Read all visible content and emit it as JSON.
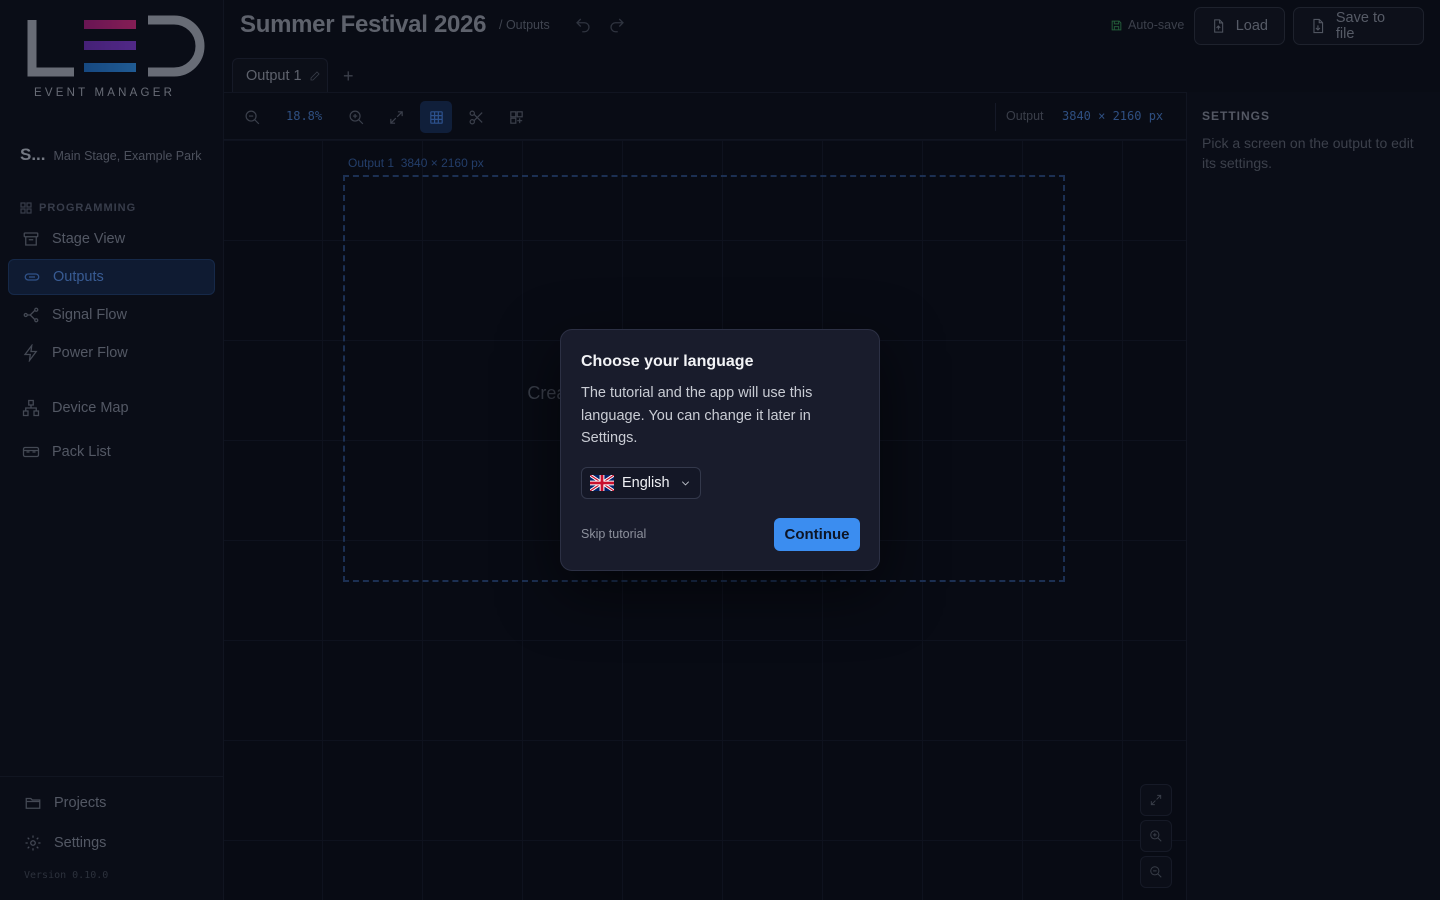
{
  "app": {
    "logo_text": "LED",
    "logo_subtitle": "EVENT MANAGER",
    "version": "Version 0.10.0"
  },
  "project": {
    "name": "S...",
    "location": "Main Stage, Example Park",
    "title": "Summer Festival 2026",
    "breadcrumb": "/ Outputs"
  },
  "sidebar": {
    "section_label": "PROGRAMMING",
    "items": [
      {
        "label": "Stage View",
        "icon": "stage-icon",
        "active": false
      },
      {
        "label": "Outputs",
        "icon": "outputs-icon",
        "active": true
      },
      {
        "label": "Signal Flow",
        "icon": "signal-flow-icon",
        "active": false
      },
      {
        "label": "Power Flow",
        "icon": "power-icon",
        "active": false
      },
      {
        "label": "Device Map",
        "icon": "device-map-icon",
        "active": false
      },
      {
        "label": "Pack List",
        "icon": "pack-list-icon",
        "active": false
      }
    ],
    "bottom": [
      {
        "label": "Projects",
        "icon": "folder-icon"
      },
      {
        "label": "Settings",
        "icon": "gear-icon"
      }
    ]
  },
  "header": {
    "autosave_label": "Auto-save",
    "load_label": "Load",
    "save_label": "Save to file"
  },
  "tabs": [
    {
      "label": "Output 1",
      "active": true
    }
  ],
  "toolbar": {
    "zoom": "18.8%",
    "output_label": "Output",
    "output_size": "3840 × 2160 px"
  },
  "canvas": {
    "output_name": "Output 1",
    "output_size": "3840 × 2160 px",
    "empty_message": "Create screens to place them on this output."
  },
  "settings_panel": {
    "title": "SETTINGS",
    "hint": "Pick a screen on the output to edit its settings."
  },
  "modal": {
    "title": "Choose your language",
    "body": "The tutorial and the app will use this language. You can change it later in Settings.",
    "language": "English",
    "skip_label": "Skip tutorial",
    "continue_label": "Continue"
  },
  "colors": {
    "accent": "#3b8df0",
    "active_nav_bg": "#13233f",
    "modal_bg": "#191c2c",
    "page_bg": "#0b0f19"
  }
}
